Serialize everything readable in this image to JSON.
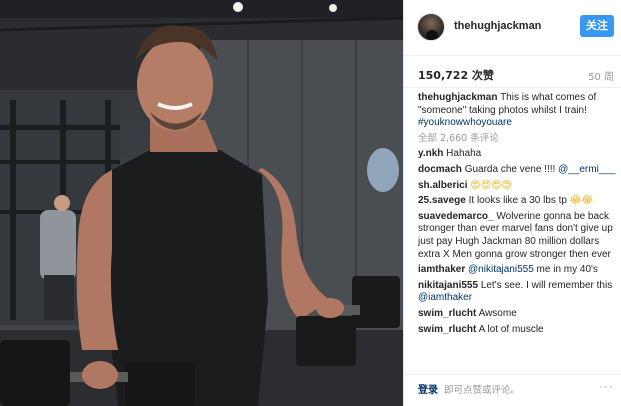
{
  "post": {
    "username": "thehughjackman",
    "follow_label": "关注",
    "likes": "150,722 次赞",
    "time_ago": "50 周",
    "view_all_comments": "全部 2,660 条评论",
    "login_label": "登录",
    "login_hint": "即可点赞或评论。",
    "more_icon": "more-options-icon"
  },
  "caption": {
    "username": "thehughjackman",
    "text": "This is what comes of \"someone\" taking photos whilst I train!",
    "hashtag": "#youknowwhoyouare"
  },
  "comments": [
    {
      "user": "y.nkh",
      "text": "Hahaha"
    },
    {
      "user": "docmach",
      "text": "Guarda che vene !!!! ",
      "mention": "@__ermi___"
    },
    {
      "user": "sh.alberici",
      "text": "",
      "emoji": "😍😍😍😍"
    },
    {
      "user": "25.savege",
      "text": "It looks like a 30 lbs tp ",
      "emoji": "😂😂"
    },
    {
      "user": "suavedemarco_",
      "text": "Wolverine gonna be back stronger than ever marvel fans don't give up just pay Hugh Jackman 80 million dollars extra X Men gonna grow stronger then ever"
    },
    {
      "user": "iamthaker",
      "mention": "@nikitajani555",
      "text": " me in my 40's"
    },
    {
      "user": "nikitajani555",
      "text": "Let's see. I will remember this ",
      "mention": "@iamthaker"
    },
    {
      "user": "swim_rlucht",
      "text": "Awsome"
    },
    {
      "user": "swim_rlucht",
      "text": "A lot of muscle"
    }
  ],
  "colors": {
    "accent": "#3897f0",
    "link": "#003569",
    "muted": "#999999"
  }
}
